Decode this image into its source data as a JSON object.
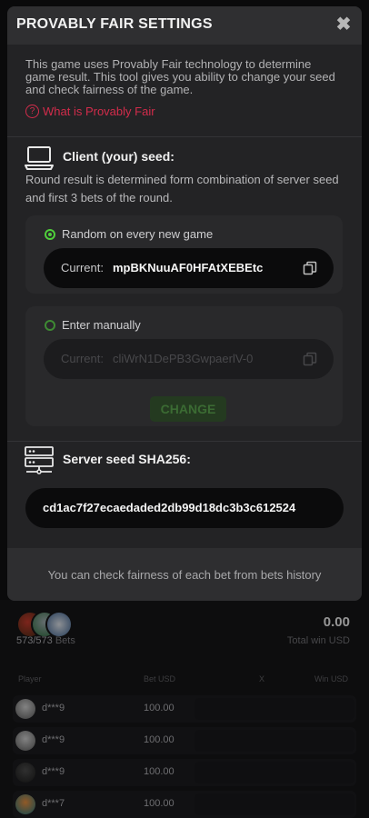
{
  "modal": {
    "title": "PROVABLY FAIR SETTINGS",
    "close_glyph": "✖",
    "intro": "This game uses Provably Fair technology to determine game result. This tool gives you ability to change your seed and check fairness of the game.",
    "help_link": "What is Provably Fair",
    "client_seed": {
      "title": "Client (your) seed:",
      "description": "Round result is determined form combination of server seed and first 3 bets of the round.",
      "option_random": {
        "label": "Random on every new game",
        "current_label": "Current:",
        "current_value": "mpBKNuuAF0HFAtXEBEtc",
        "selected": true
      },
      "option_manual": {
        "label": "Enter manually",
        "current_label": "Current:",
        "current_value": "cliWrN1DePB3GwpaerlV-0",
        "selected": false
      },
      "change_button": "CHANGE"
    },
    "server_seed": {
      "title": "Server seed SHA256:",
      "value": "cd1ac7f27ecaedaded2db99d18dc3b3c612524"
    },
    "footer": "You can check fairness of each bet from bets history"
  },
  "bets_panel": {
    "bets_count": "573/573",
    "bets_label": "Bets",
    "total_win_value": "0.00",
    "total_win_label": "Total win USD",
    "columns": [
      "Player",
      "Bet USD",
      "X",
      "Win USD"
    ],
    "rows": [
      {
        "player": "d***9",
        "bet": "100.00"
      },
      {
        "player": "d***9",
        "bet": "100.00"
      },
      {
        "player": "d***9",
        "bet": "100.00"
      },
      {
        "player": "d***7",
        "bet": "100.00"
      }
    ]
  },
  "colors": {
    "accent_green": "#4fcf3b",
    "link_red": "#d22c4b",
    "modal_bg": "#232325"
  },
  "icons": [
    "laptop-icon",
    "server-icon",
    "copy-icon",
    "close-icon",
    "question-icon"
  ]
}
